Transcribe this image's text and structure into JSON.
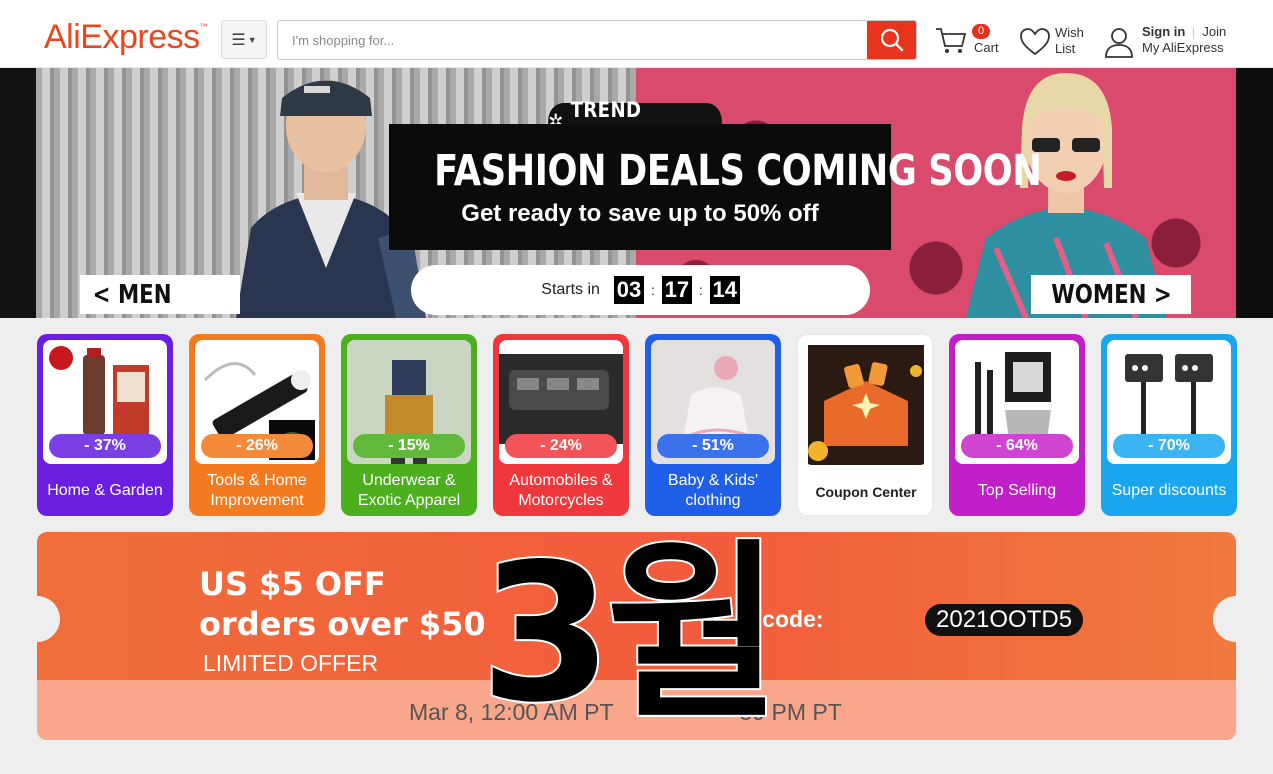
{
  "header": {
    "logo": "AliExpress",
    "logo_tm": "™",
    "search_placeholder": "I'm shopping for...",
    "cart_count": "0",
    "cart_label": "Cart",
    "wish_label_1": "Wish",
    "wish_label_2": "List",
    "sign_in": "Sign in",
    "join": "Join",
    "my_account": "My AliExpress"
  },
  "hero": {
    "trend": "TREND SPOTTING",
    "headline": "FASHION DEALS COMING SOON",
    "subline": "Get ready to save up to 50% off",
    "starts_label": "Starts in",
    "countdown": {
      "h": "03",
      "m": "17",
      "s": "14"
    },
    "men_label": "< MEN",
    "women_label": "WOMEN >"
  },
  "categories": [
    {
      "label": "Home & Garden",
      "discount": "- 37%",
      "color": "#6a1fe0",
      "pct_color": "#7b3fe6"
    },
    {
      "label": "Tools & Home Improvement",
      "discount": "- 26%",
      "color": "#f47a1f",
      "pct_color": "#f28a3a"
    },
    {
      "label": "Underwear & Exotic Apparel",
      "discount": "- 15%",
      "color": "#4caf1e",
      "pct_color": "#62b83a"
    },
    {
      "label": "Automobiles & Motorcycles",
      "discount": "- 24%",
      "color": "#f0373b",
      "pct_color": "#f2545a"
    },
    {
      "label": "Baby & Kids' clothing",
      "discount": "- 51%",
      "color": "#1f5fe8",
      "pct_color": "#3a72ec"
    },
    {
      "label": "Coupon Center",
      "discount": "",
      "color": "#ffffff",
      "pct_color": ""
    },
    {
      "label": "Top Selling",
      "discount": "- 64%",
      "color": "#c21ec9",
      "pct_color": "#cf44d2"
    },
    {
      "label": "Super discounts",
      "discount": "- 70%",
      "color": "#19a6ef",
      "pct_color": "#3bb4f1"
    }
  ],
  "coupon": {
    "title_1": "US $5 OFF",
    "title_2": "orders over $50",
    "limited": "LIMITED OFFER",
    "code_label": "y code:",
    "code": "2021OOTD5",
    "date_left": "Mar 8, 12:00 AM PT",
    "date_right": "59 PM PT"
  },
  "overlay": {
    "text": "3월"
  },
  "colors": {
    "brand": "#e8471e",
    "search_button": "#e8341c",
    "cart_badge": "#e5301c"
  }
}
